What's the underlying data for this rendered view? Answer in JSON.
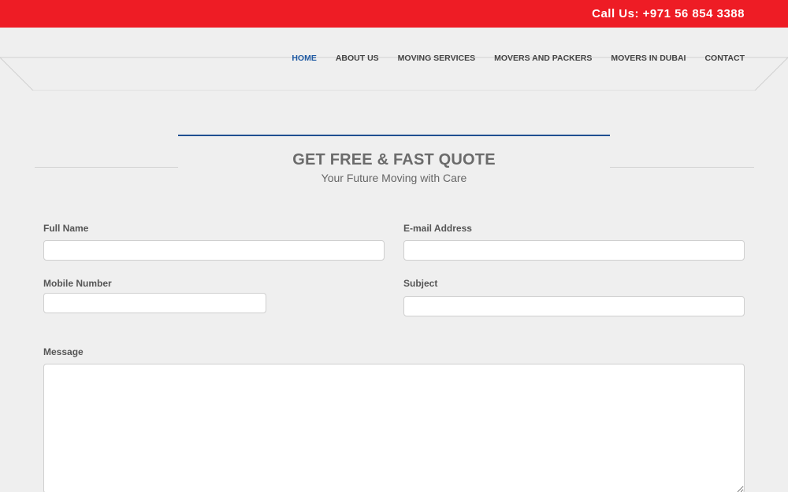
{
  "topbar": {
    "call_text": "Call Us: +971 56 854 3388",
    "color": "#ee1c25"
  },
  "nav": {
    "items": [
      {
        "label": "HOME",
        "active": true
      },
      {
        "label": "ABOUT US"
      },
      {
        "label": "MOVING SERVICES"
      },
      {
        "label": "MOVERS AND PACKERS"
      },
      {
        "label": "MOVERS IN DUBAI"
      },
      {
        "label": "CONTACT"
      }
    ],
    "active_color": "#1f5aa3"
  },
  "section": {
    "title": "GET FREE & FAST QUOTE",
    "subtitle": "Your Future Moving with Care"
  },
  "form": {
    "full_name": {
      "label": "Full Name",
      "value": ""
    },
    "email": {
      "label": "E-mail Address",
      "value": ""
    },
    "mobile": {
      "label": "Mobile Number",
      "value": ""
    },
    "subject": {
      "label": "Subject",
      "value": ""
    },
    "message": {
      "label": "Message",
      "value": ""
    }
  }
}
